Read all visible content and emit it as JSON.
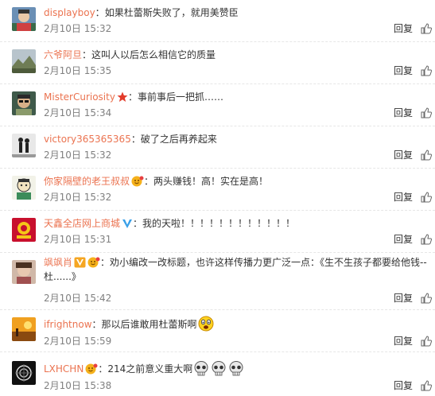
{
  "comments": [
    {
      "username": "displayboy",
      "text": "如果杜蕾斯失败了，就用美赞臣",
      "time": "2月10日 15:32",
      "reply": "回复"
    },
    {
      "username": "六爷阿旦",
      "text": "这叫人以后怎么相信它的质量",
      "time": "2月10日 15:35",
      "reply": "回复"
    },
    {
      "username": "MisterCuriosity",
      "badge": "star-icon",
      "text": "事前事后一把抓……",
      "time": "2月10日 15:34",
      "reply": "回复"
    },
    {
      "username": "victory365365365",
      "text": "破了之后再养起来",
      "time": "2月10日 15:32",
      "reply": "回复"
    },
    {
      "username": "你家隔壁的老王叔叔",
      "badge": "member-icon",
      "text": "两头赚钱！高！实在是高！",
      "time": "2月10日 15:32",
      "reply": "回复"
    },
    {
      "username": "天鑫全店网上商城",
      "badge": "verified-v-icon",
      "text": "我的天啦！！！！！！！！！！！！",
      "time": "2月10日 15:31",
      "reply": "回复"
    },
    {
      "username": "飒飒肖",
      "badge": "vip-v-icon",
      "text": "劝小编改一改标题，也许这样传播力更广泛一点：《生不生孩子都要给他钱--杜......》",
      "time": "2月10日 15:42",
      "reply": "回复"
    },
    {
      "username": "ifrightnow",
      "text": "那以后谁敢用杜蕾斯啊",
      "emoji": "shocked-face-icon",
      "time": "2月10日 15:59",
      "reply": "回复"
    },
    {
      "username": "LXHCHN",
      "badge": "member-icon",
      "text": "214之前意义重大啊",
      "emoji": "skull-icon",
      "time": "2月10日 15:38",
      "reply": "回复"
    }
  ],
  "colors": {
    "username": "#eb7350",
    "text": "#333333",
    "meta": "#808080"
  }
}
